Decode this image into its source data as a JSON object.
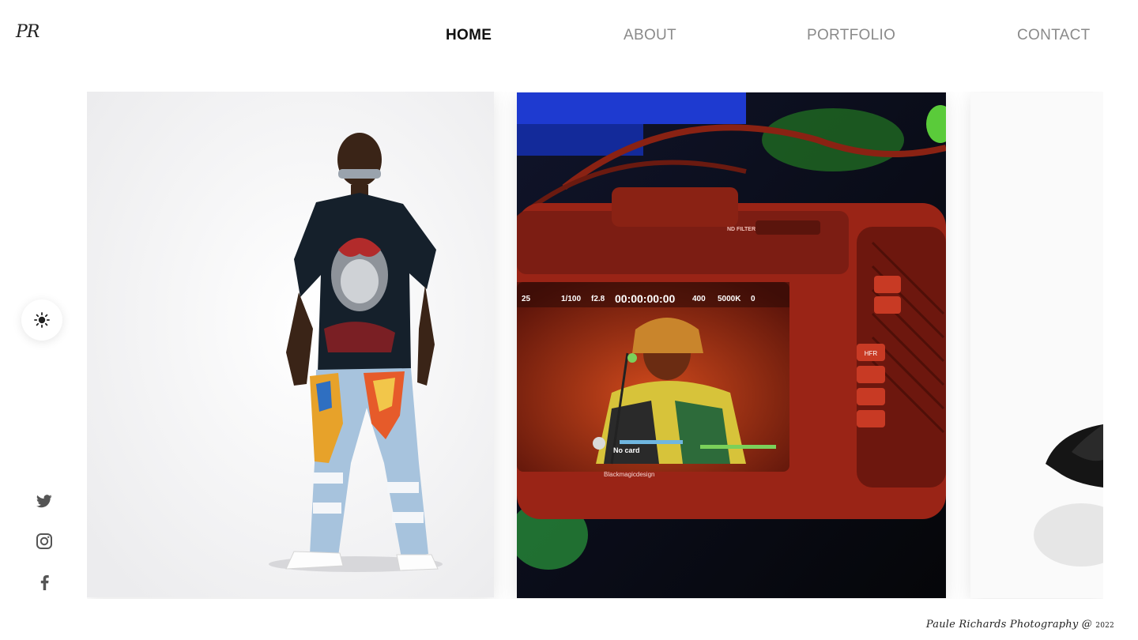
{
  "logo": {
    "text": "PR"
  },
  "nav": {
    "items": [
      {
        "label": "HOME",
        "active": true
      },
      {
        "label": "ABOUT",
        "active": false
      },
      {
        "label": "PORTFOLIO",
        "active": false
      },
      {
        "label": "CONTACT",
        "active": false
      }
    ]
  },
  "theme_toggle": {
    "icon": "sun-icon"
  },
  "social": [
    {
      "icon": "twitter-icon"
    },
    {
      "icon": "instagram-icon"
    },
    {
      "icon": "facebook-icon"
    }
  ],
  "camera_screen": {
    "timecode": "00:00:00:00",
    "shutter": "1/100",
    "aperture": "f2.8",
    "fps": "25",
    "iso": "400",
    "wb": "5000K",
    "tint": "0",
    "status": "No card",
    "brand": "Blackmagicdesign",
    "nd_filter": "ND FILTER",
    "button_hfr": "HFR"
  },
  "footer": {
    "text": "Paule Richards Photography @",
    "year": "2022"
  },
  "colors": {
    "nav_active": "#111111",
    "nav_inactive": "#8a8a8a",
    "camera_body": "#b52d1d"
  }
}
